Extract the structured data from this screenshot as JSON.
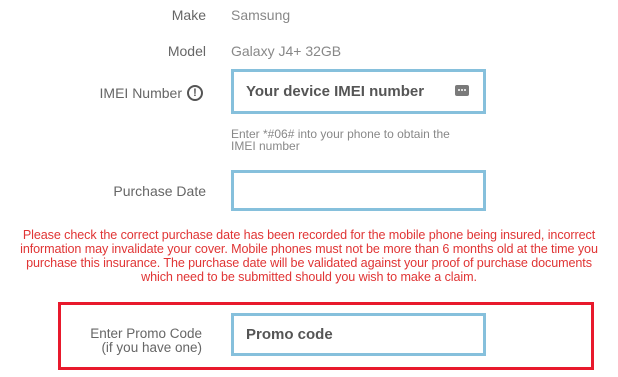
{
  "device": {
    "make_label": "Make",
    "make_value": "Samsung",
    "model_label": "Model",
    "model_value": "Galaxy J4+ 32GB"
  },
  "imei": {
    "label": "IMEI Number",
    "info_symbol": "!",
    "placeholder": "Your device IMEI number",
    "hint_line1": "Enter *#06# into your phone to obtain the",
    "hint_line2": "IMEI number"
  },
  "purchase_date": {
    "label": "Purchase Date",
    "value": ""
  },
  "warning": {
    "line1": "Please check the correct purchase date has been recorded for the mobile phone being insured, incorrect",
    "line2": "information may invalidate your cover. Mobile phones must not be more than 6 months old at the time you",
    "line3": "purchase this insurance. The purchase date will be validated against your proof of purchase documents",
    "line4": "which need to be submitted should you wish to make a claim."
  },
  "promo": {
    "label_line1": "Enter Promo Code",
    "label_line2": "(if you have one)",
    "placeholder": "Promo code"
  },
  "colors": {
    "field_border": "#86c0dc",
    "warning_text": "#e03535",
    "highlight_border": "#e8192c"
  },
  "icons": {
    "info": "info-circle-icon",
    "imei_keypad": "keypad-icon"
  }
}
